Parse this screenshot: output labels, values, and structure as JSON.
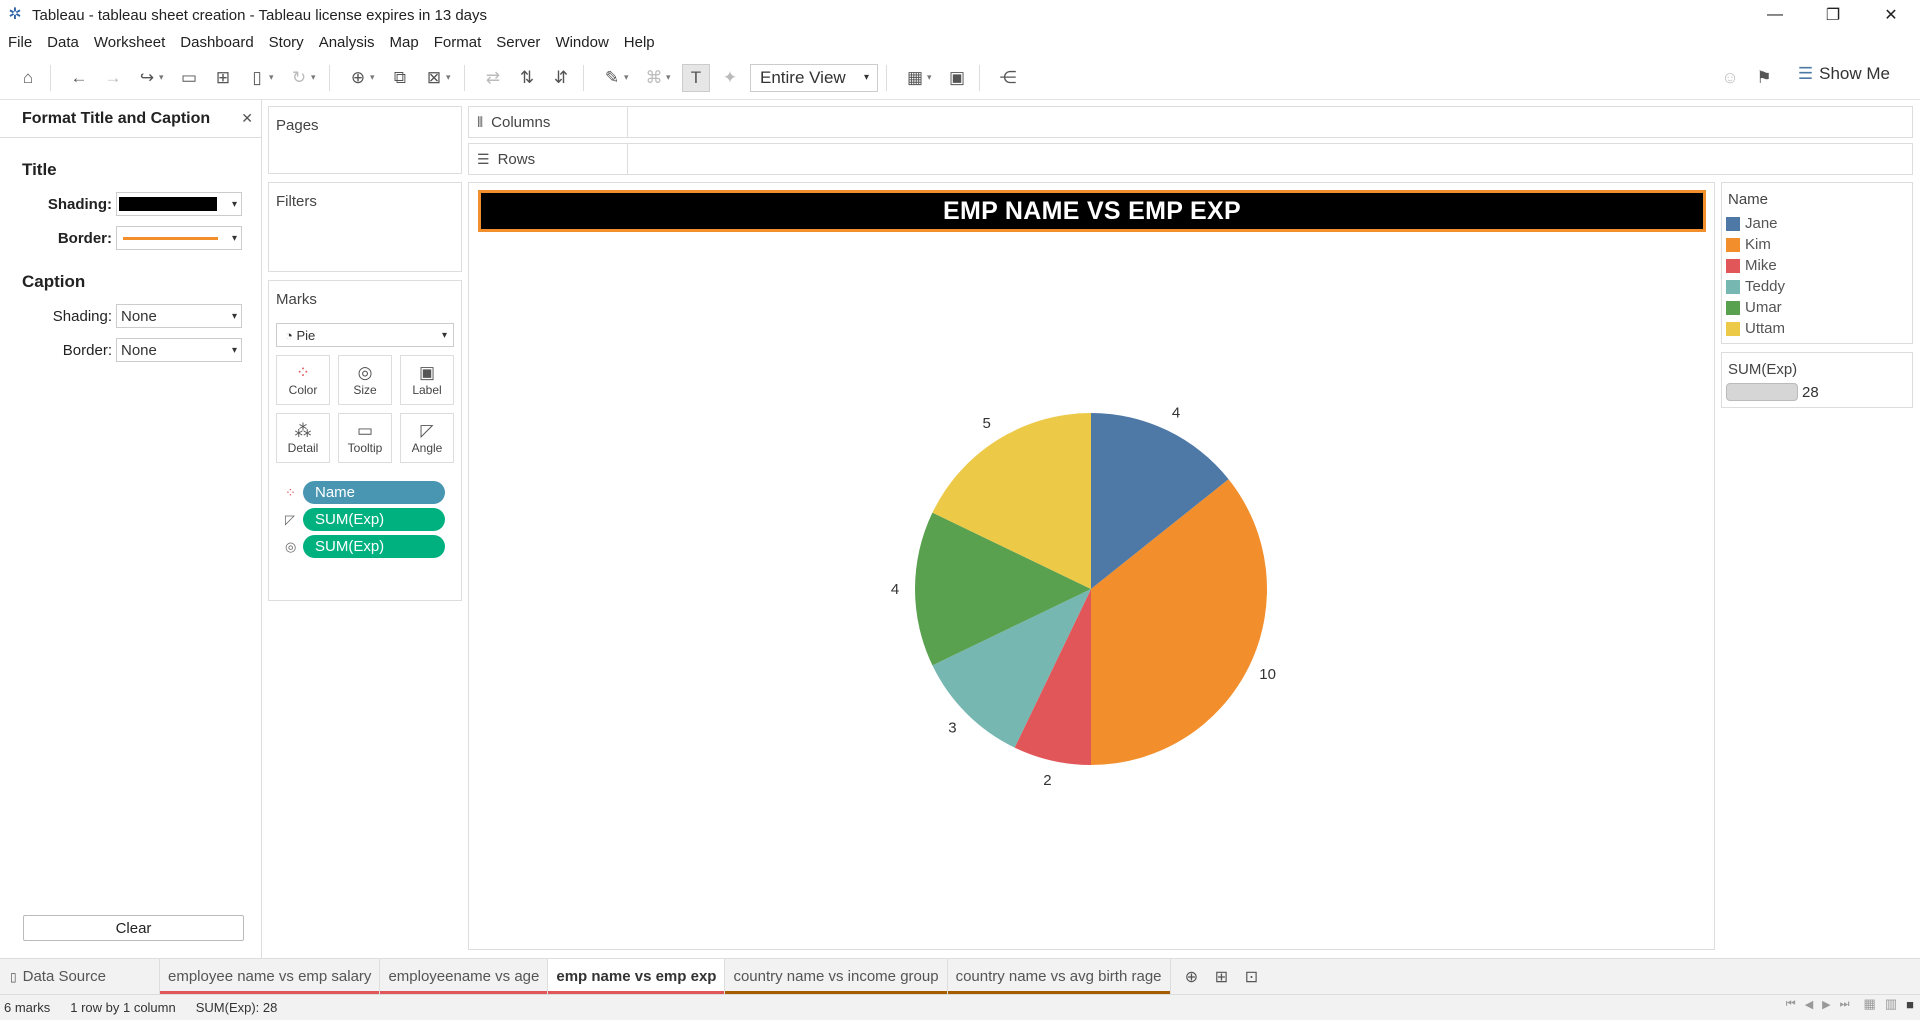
{
  "window": {
    "title": "Tableau - tableau sheet creation - Tableau license expires in 13 days"
  },
  "menu": [
    "File",
    "Data",
    "Worksheet",
    "Dashboard",
    "Story",
    "Analysis",
    "Map",
    "Format",
    "Server",
    "Window",
    "Help"
  ],
  "toolbar": {
    "fit_value": "Entire View",
    "show_me_label": "Show Me"
  },
  "format_panel": {
    "header": "Format Title and Caption",
    "title_section": "Title",
    "caption_section": "Caption",
    "shading_label": "Shading:",
    "border_label": "Border:",
    "caption_shading_value": "None",
    "caption_border_value": "None",
    "clear_label": "Clear"
  },
  "shelves": {
    "pages": "Pages",
    "filters": "Filters",
    "marks": "Marks",
    "columns": "Columns",
    "rows": "Rows"
  },
  "marks": {
    "type": "Pie",
    "buttons": [
      "Color",
      "Size",
      "Label",
      "Detail",
      "Tooltip",
      "Angle"
    ],
    "pills": [
      "Name",
      "SUM(Exp)",
      "SUM(Exp)"
    ]
  },
  "sheet": {
    "title": "EMP NAME VS EMP EXP"
  },
  "chart_data": {
    "type": "pie",
    "title": "EMP NAME VS EMP EXP",
    "categories": [
      "Jane",
      "Kim",
      "Mike",
      "Teddy",
      "Umar",
      "Uttam"
    ],
    "values": [
      4,
      10,
      2,
      3,
      4,
      5
    ],
    "colors": [
      "#4e79a7",
      "#f28e2b",
      "#e15759",
      "#76b7b2",
      "#59a14f",
      "#edc948"
    ],
    "legend_title": "Name",
    "legend_position": "right"
  },
  "size_legend": {
    "title": "SUM(Exp)",
    "value": "28"
  },
  "tabs": {
    "data_source": "Data Source",
    "sheets": [
      {
        "label": "employee name vs emp salary",
        "accent": "#e15759"
      },
      {
        "label": "employeename vs age",
        "accent": "#e15759"
      },
      {
        "label": "emp name vs emp exp",
        "accent": "#e15759",
        "active": true
      },
      {
        "label": "country name vs income group",
        "accent": "#a65c00"
      },
      {
        "label": "country name vs avg birth rage",
        "accent": "#a65c00"
      }
    ]
  },
  "status": {
    "marks": "6 marks",
    "layout": "1 row by 1 column",
    "sum": "SUM(Exp): 28"
  }
}
